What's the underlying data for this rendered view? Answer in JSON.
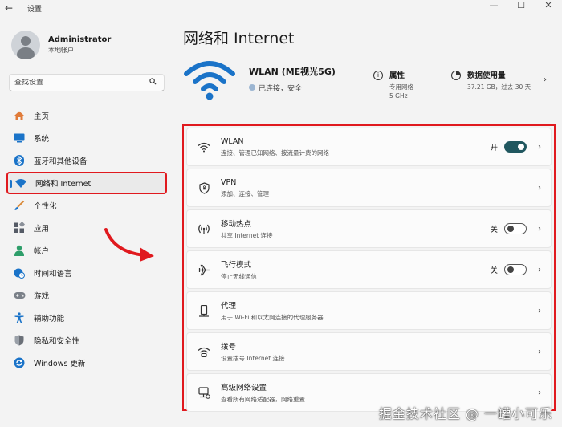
{
  "window": {
    "title": "设置",
    "back": "←",
    "minimize": "—",
    "maximize": "☐",
    "close": "✕"
  },
  "user": {
    "name": "Administrator",
    "account": "本地帐户"
  },
  "search": {
    "placeholder": "查找设置"
  },
  "nav": [
    {
      "label": "主页",
      "icon": "home-icon",
      "color": "#e07b39"
    },
    {
      "label": "系统",
      "icon": "system-icon",
      "color": "#1a73c8"
    },
    {
      "label": "蓝牙和其他设备",
      "icon": "bluetooth-icon",
      "color": "#1a73c8"
    },
    {
      "label": "网络和 Internet",
      "icon": "network-icon",
      "color": "#1a73c8"
    },
    {
      "label": "个性化",
      "icon": "brush-icon",
      "color": "#d98a3a"
    },
    {
      "label": "应用",
      "icon": "apps-icon",
      "color": "#555b66"
    },
    {
      "label": "帐户",
      "icon": "account-icon",
      "color": "#2e9e6a"
    },
    {
      "label": "时间和语言",
      "icon": "globe-clock-icon",
      "color": "#1a73c8"
    },
    {
      "label": "游戏",
      "icon": "gamepad-icon",
      "color": "#7a8088"
    },
    {
      "label": "辅助功能",
      "icon": "accessibility-icon",
      "color": "#1a73c8"
    },
    {
      "label": "隐私和安全性",
      "icon": "shield-icon",
      "color": "#6b7078"
    },
    {
      "label": "Windows 更新",
      "icon": "update-icon",
      "color": "#1a73c8"
    }
  ],
  "page": {
    "title": "网络和 Internet"
  },
  "hero": {
    "ssid": "WLAN (ME视光5G)",
    "status": "已连接，安全",
    "props_title": "属性",
    "props_line1": "专用网络",
    "props_line2": "5 GHz",
    "usage_title": "数据使用量",
    "usage_line": "37.21 GB，过去 30 天"
  },
  "cards": [
    {
      "title": "WLAN",
      "desc": "连接、管理已知网络、按流量计费的网络",
      "state": "开",
      "toggle": "on",
      "icon": "wifi-icon"
    },
    {
      "title": "VPN",
      "desc": "添加、连接、管理",
      "state": "",
      "toggle": "",
      "icon": "vpn-shield-icon"
    },
    {
      "title": "移动热点",
      "desc": "共享 Internet 连接",
      "state": "关",
      "toggle": "off",
      "icon": "hotspot-icon"
    },
    {
      "title": "飞行模式",
      "desc": "停止无线通信",
      "state": "关",
      "toggle": "off",
      "icon": "airplane-icon"
    },
    {
      "title": "代理",
      "desc": "用于 Wi-Fi 和以太网连接的代理服务器",
      "state": "",
      "toggle": "",
      "icon": "proxy-icon"
    },
    {
      "title": "拨号",
      "desc": "设置拨号 Internet 连接",
      "state": "",
      "toggle": "",
      "icon": "dialup-icon"
    },
    {
      "title": "高级网络设置",
      "desc": "查看所有网络适配器，网络重置",
      "state": "",
      "toggle": "",
      "icon": "advanced-network-icon"
    }
  ],
  "colors": {
    "accent": "#20575f",
    "highlight_border": "#e0191e",
    "wifi_blue": "#1a73c8"
  },
  "watermark": "掘金技术社区 @ 一罐小可乐"
}
